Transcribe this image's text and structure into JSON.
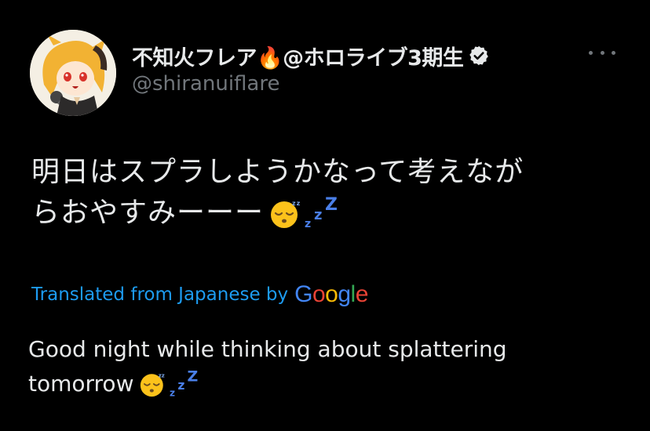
{
  "profile": {
    "display_name": "不知火フレア🔥@ホロライブ3期生",
    "handle": "@shiranuiflare"
  },
  "tweet": {
    "text_line1": "明日はスプラしようかなって考えなが",
    "text_line2": "らおやすみーーー"
  },
  "translation": {
    "label": "Translated from Japanese by",
    "provider": "Google",
    "text_line1": "Good night while thinking about splattering",
    "text_line2": "tomorrow"
  },
  "colors": {
    "background": "#000000",
    "text": "#e7e9ea",
    "secondary": "#71767b",
    "link": "#1d9bf0"
  },
  "icons": [
    "avatar",
    "verified-badge-icon",
    "more-icon",
    "sleeping-face-emoji",
    "zzz-emoji"
  ]
}
